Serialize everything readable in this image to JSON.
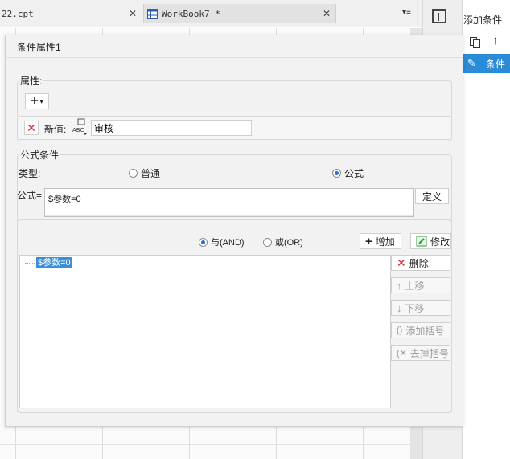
{
  "tabs": [
    {
      "label": "22.cpt"
    },
    {
      "label": "WorkBook7 *"
    }
  ],
  "right_panel": {
    "title": "添加条件",
    "selected_item": "条件"
  },
  "dialog": {
    "title": "条件属性1",
    "properties": {
      "group_label": "属性:",
      "new_value_label": "新值:",
      "new_value": "审核"
    },
    "formula_condition": {
      "group_label": "公式条件",
      "type_label": "类型:",
      "type_options": [
        "普通",
        "公式"
      ],
      "selected_type": "公式",
      "formula_label": "公式=",
      "formula_value": "$参数=0",
      "define_button": "定义",
      "logic_options": [
        "与(AND)",
        "或(OR)"
      ],
      "selected_logic": "与(AND)",
      "add_button": "增加",
      "edit_button": "修改",
      "conditions": [
        "$参数=0"
      ],
      "side_buttons": {
        "delete": "删除",
        "move_up": "上移",
        "move_down": "下移",
        "add_paren": "添加括号",
        "remove_paren": "去掉括号"
      }
    }
  },
  "colors": {
    "accent": "#2a8bd6",
    "delete": "#d8262b",
    "selection": "#3b8fd8",
    "add_green": "#2a9d3a"
  }
}
